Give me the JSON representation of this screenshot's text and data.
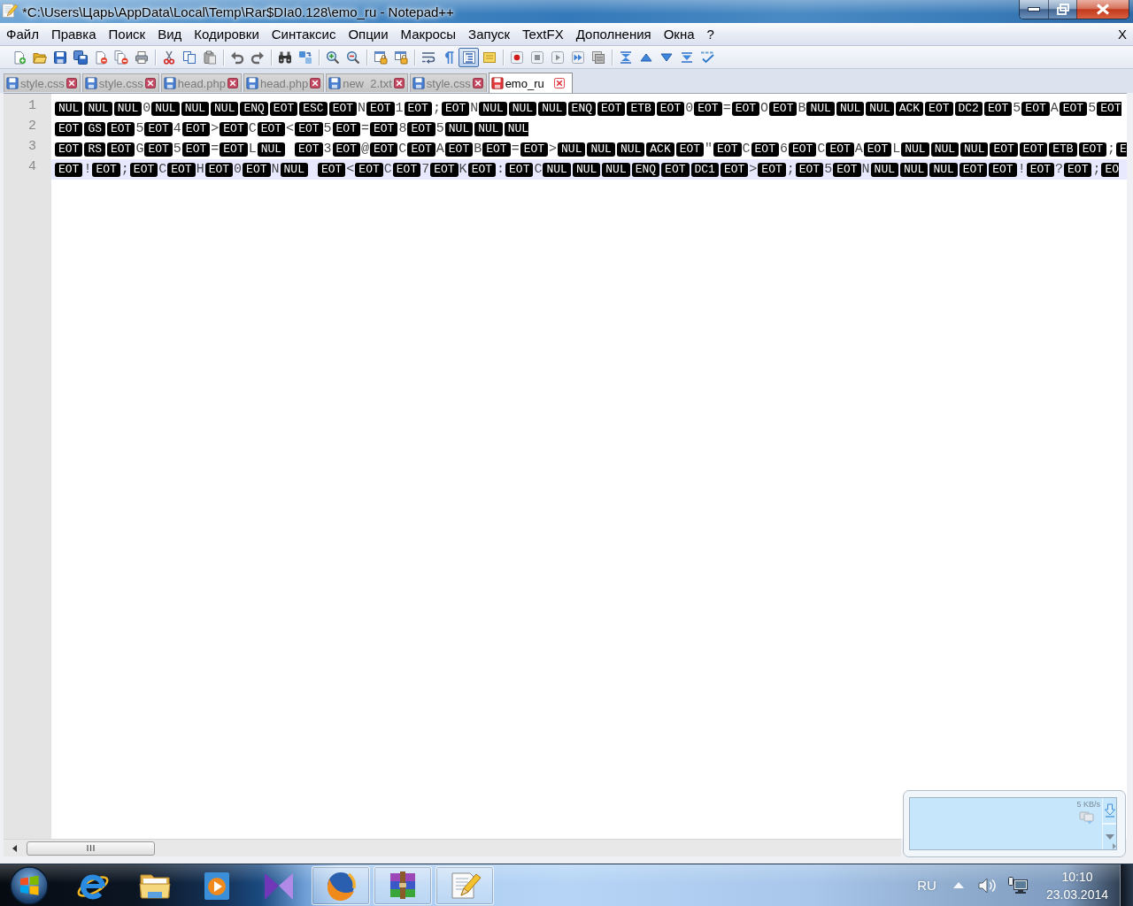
{
  "window": {
    "title": "*C:\\Users\\Царь\\AppData\\Local\\Temp\\Rar$DIa0.128\\emo_ru - Notepad++"
  },
  "menu": {
    "items": [
      "Файл",
      "Правка",
      "Поиск",
      "Вид",
      "Кодировки",
      "Синтаксис",
      "Опции",
      "Макросы",
      "Запуск",
      "TextFX",
      "Дополнения",
      "Окна",
      "?"
    ],
    "close": "X"
  },
  "toolbar": {
    "groups": [
      [
        {
          "kind": "new",
          "pressed": false
        },
        {
          "kind": "open",
          "pressed": false
        },
        {
          "kind": "save",
          "pressed": false
        },
        {
          "kind": "saveall",
          "pressed": false
        },
        {
          "kind": "close",
          "pressed": false
        },
        {
          "kind": "closeall",
          "pressed": false
        },
        {
          "kind": "print",
          "pressed": false
        }
      ],
      [
        {
          "kind": "cut",
          "pressed": false
        },
        {
          "kind": "copy",
          "pressed": false
        },
        {
          "kind": "paste",
          "pressed": false
        }
      ],
      [
        {
          "kind": "undo",
          "pressed": false
        },
        {
          "kind": "redo",
          "pressed": false
        }
      ],
      [
        {
          "kind": "find",
          "pressed": false
        },
        {
          "kind": "replace",
          "pressed": false
        }
      ],
      [
        {
          "kind": "zoomin",
          "pressed": false
        },
        {
          "kind": "zoomout",
          "pressed": false
        }
      ],
      [
        {
          "kind": "syncv",
          "pressed": false
        },
        {
          "kind": "synch",
          "pressed": false
        }
      ],
      [
        {
          "kind": "wrap",
          "pressed": false
        },
        {
          "kind": "allchars",
          "pressed": false
        },
        {
          "kind": "indent",
          "pressed": true
        },
        {
          "kind": "userlang",
          "pressed": false
        }
      ],
      [
        {
          "kind": "record",
          "pressed": false
        },
        {
          "kind": "stop",
          "pressed": false
        },
        {
          "kind": "play",
          "pressed": false
        },
        {
          "kind": "playmulti",
          "pressed": false
        },
        {
          "kind": "savemacro",
          "pressed": false
        }
      ],
      [
        {
          "kind": "collapse",
          "pressed": false
        },
        {
          "kind": "up",
          "pressed": false
        },
        {
          "kind": "down",
          "pressed": false
        },
        {
          "kind": "expand",
          "pressed": false
        },
        {
          "kind": "spell",
          "pressed": false
        }
      ]
    ]
  },
  "tabs": [
    {
      "label": "style.css",
      "selected": false,
      "modified": false
    },
    {
      "label": "style.css",
      "selected": false,
      "modified": false
    },
    {
      "label": "head.php",
      "selected": false,
      "modified": false
    },
    {
      "label": "head.php",
      "selected": false,
      "modified": false
    },
    {
      "label": "new  2.txt",
      "selected": false,
      "modified": false
    },
    {
      "label": "style.css",
      "selected": false,
      "modified": false
    },
    {
      "label": "emo_ru",
      "selected": true,
      "modified": true
    }
  ],
  "editor": {
    "lines": [
      {
        "number": "1",
        "current": false,
        "tokens": [
          {
            "kind": "control",
            "text": "NUL"
          },
          {
            "kind": "control",
            "text": "NUL"
          },
          {
            "kind": "control",
            "text": "NUL"
          },
          {
            "kind": "char",
            "text": "0"
          },
          {
            "kind": "control",
            "text": "NUL"
          },
          {
            "kind": "control",
            "text": "NUL"
          },
          {
            "kind": "control",
            "text": "NUL"
          },
          {
            "kind": "control",
            "text": "ENQ"
          },
          {
            "kind": "control",
            "text": "EOT"
          },
          {
            "kind": "control",
            "text": "ESC"
          },
          {
            "kind": "control",
            "text": "EOT"
          },
          {
            "kind": "char",
            "text": "N"
          },
          {
            "kind": "control",
            "text": "EOT"
          },
          {
            "kind": "char",
            "text": "1"
          },
          {
            "kind": "control",
            "text": "EOT"
          },
          {
            "kind": "char",
            "text": ";"
          },
          {
            "kind": "control",
            "text": "EOT"
          },
          {
            "kind": "char",
            "text": "N"
          },
          {
            "kind": "control",
            "text": "NUL"
          },
          {
            "kind": "control",
            "text": "NUL"
          },
          {
            "kind": "control",
            "text": "NUL"
          },
          {
            "kind": "control",
            "text": "ENQ"
          },
          {
            "kind": "control",
            "text": "EOT"
          },
          {
            "kind": "control",
            "text": "ETB"
          },
          {
            "kind": "control",
            "text": "EOT"
          },
          {
            "kind": "char",
            "text": "0"
          },
          {
            "kind": "control",
            "text": "EOT"
          },
          {
            "kind": "char",
            "text": "="
          },
          {
            "kind": "control",
            "text": "EOT"
          },
          {
            "kind": "char",
            "text": "O"
          },
          {
            "kind": "control",
            "text": "EOT"
          },
          {
            "kind": "char",
            "text": "B"
          },
          {
            "kind": "control",
            "text": "NUL"
          },
          {
            "kind": "control",
            "text": "NUL"
          },
          {
            "kind": "control",
            "text": "NUL"
          },
          {
            "kind": "control",
            "text": "ACK"
          },
          {
            "kind": "control",
            "text": "EOT"
          },
          {
            "kind": "control",
            "text": "DC2"
          },
          {
            "kind": "control",
            "text": "EOT"
          },
          {
            "kind": "char",
            "text": "5"
          },
          {
            "kind": "control",
            "text": "EOT"
          },
          {
            "kind": "char",
            "text": "A"
          },
          {
            "kind": "control",
            "text": "EOT"
          },
          {
            "kind": "char",
            "text": "5"
          },
          {
            "kind": "control",
            "text": "EOT"
          }
        ]
      },
      {
        "number": "2",
        "current": false,
        "tokens": [
          {
            "kind": "control",
            "text": "EOT"
          },
          {
            "kind": "control",
            "text": "GS"
          },
          {
            "kind": "control",
            "text": "EOT"
          },
          {
            "kind": "char",
            "text": "5"
          },
          {
            "kind": "control",
            "text": "EOT"
          },
          {
            "kind": "char",
            "text": "4"
          },
          {
            "kind": "control",
            "text": "EOT"
          },
          {
            "kind": "char",
            "text": ">"
          },
          {
            "kind": "control",
            "text": "EOT"
          },
          {
            "kind": "char",
            "text": "C"
          },
          {
            "kind": "control",
            "text": "EOT"
          },
          {
            "kind": "char",
            "text": "<"
          },
          {
            "kind": "control",
            "text": "EOT"
          },
          {
            "kind": "char",
            "text": "5"
          },
          {
            "kind": "control",
            "text": "EOT"
          },
          {
            "kind": "char",
            "text": "="
          },
          {
            "kind": "control",
            "text": "EOT"
          },
          {
            "kind": "char",
            "text": "8"
          },
          {
            "kind": "control",
            "text": "EOT"
          },
          {
            "kind": "char",
            "text": "5"
          },
          {
            "kind": "control",
            "text": "NUL"
          },
          {
            "kind": "control",
            "text": "NUL"
          },
          {
            "kind": "control",
            "text": "NUL"
          }
        ]
      },
      {
        "number": "3",
        "current": false,
        "tokens": [
          {
            "kind": "control",
            "text": "EOT"
          },
          {
            "kind": "control",
            "text": "RS"
          },
          {
            "kind": "control",
            "text": "EOT"
          },
          {
            "kind": "char",
            "text": "G"
          },
          {
            "kind": "control",
            "text": "EOT"
          },
          {
            "kind": "char",
            "text": "5"
          },
          {
            "kind": "control",
            "text": "EOT"
          },
          {
            "kind": "char",
            "text": "="
          },
          {
            "kind": "control",
            "text": "EOT"
          },
          {
            "kind": "char",
            "text": "L"
          },
          {
            "kind": "control",
            "text": "NUL"
          },
          {
            "kind": "space"
          },
          {
            "kind": "control",
            "text": "EOT"
          },
          {
            "kind": "char",
            "text": "3"
          },
          {
            "kind": "control",
            "text": "EOT"
          },
          {
            "kind": "char",
            "text": "@"
          },
          {
            "kind": "control",
            "text": "EOT"
          },
          {
            "kind": "char",
            "text": "C"
          },
          {
            "kind": "control",
            "text": "EOT"
          },
          {
            "kind": "char",
            "text": "A"
          },
          {
            "kind": "control",
            "text": "EOT"
          },
          {
            "kind": "char",
            "text": "B"
          },
          {
            "kind": "control",
            "text": "EOT"
          },
          {
            "kind": "char",
            "text": "="
          },
          {
            "kind": "control",
            "text": "EOT"
          },
          {
            "kind": "char",
            "text": ">"
          },
          {
            "kind": "control",
            "text": "NUL"
          },
          {
            "kind": "control",
            "text": "NUL"
          },
          {
            "kind": "control",
            "text": "NUL"
          },
          {
            "kind": "control",
            "text": "ACK"
          },
          {
            "kind": "control",
            "text": "EOT"
          },
          {
            "kind": "char",
            "text": "\""
          },
          {
            "kind": "control",
            "text": "EOT"
          },
          {
            "kind": "char",
            "text": "C"
          },
          {
            "kind": "control",
            "text": "EOT"
          },
          {
            "kind": "char",
            "text": "6"
          },
          {
            "kind": "control",
            "text": "EOT"
          },
          {
            "kind": "char",
            "text": "C"
          },
          {
            "kind": "control",
            "text": "EOT"
          },
          {
            "kind": "char",
            "text": "A"
          },
          {
            "kind": "control",
            "text": "EOT"
          },
          {
            "kind": "char",
            "text": "L"
          },
          {
            "kind": "control",
            "text": "NUL"
          },
          {
            "kind": "control",
            "text": "NUL"
          },
          {
            "kind": "control",
            "text": "NUL"
          },
          {
            "kind": "control",
            "text": "EOT"
          },
          {
            "kind": "control",
            "text": "EOT"
          },
          {
            "kind": "control",
            "text": "ETB"
          },
          {
            "kind": "control",
            "text": "EOT"
          },
          {
            "kind": "char",
            "text": ";"
          },
          {
            "kind": "control",
            "text": "E"
          }
        ]
      },
      {
        "number": "4",
        "current": true,
        "tokens": [
          {
            "kind": "control",
            "text": "EOT"
          },
          {
            "kind": "char",
            "text": "!"
          },
          {
            "kind": "control",
            "text": "EOT"
          },
          {
            "kind": "char",
            "text": ";"
          },
          {
            "kind": "control",
            "text": "EOT"
          },
          {
            "kind": "char",
            "text": "C"
          },
          {
            "kind": "control",
            "text": "EOT"
          },
          {
            "kind": "char",
            "text": "H"
          },
          {
            "kind": "control",
            "text": "EOT"
          },
          {
            "kind": "char",
            "text": "0"
          },
          {
            "kind": "control",
            "text": "EOT"
          },
          {
            "kind": "char",
            "text": "N"
          },
          {
            "kind": "control",
            "text": "NUL"
          },
          {
            "kind": "space"
          },
          {
            "kind": "control",
            "text": "EOT"
          },
          {
            "kind": "char",
            "text": "<"
          },
          {
            "kind": "control",
            "text": "EOT"
          },
          {
            "kind": "char",
            "text": "C"
          },
          {
            "kind": "control",
            "text": "EOT"
          },
          {
            "kind": "char",
            "text": "7"
          },
          {
            "kind": "control",
            "text": "EOT"
          },
          {
            "kind": "char",
            "text": "K"
          },
          {
            "kind": "control",
            "text": "EOT"
          },
          {
            "kind": "char",
            "text": ":"
          },
          {
            "kind": "control",
            "text": "EOT"
          },
          {
            "kind": "char",
            "text": "C"
          },
          {
            "kind": "control",
            "text": "NUL"
          },
          {
            "kind": "control",
            "text": "NUL"
          },
          {
            "kind": "control",
            "text": "NUL"
          },
          {
            "kind": "control",
            "text": "ENQ"
          },
          {
            "kind": "control",
            "text": "EOT"
          },
          {
            "kind": "control",
            "text": "DC1"
          },
          {
            "kind": "control",
            "text": "EOT"
          },
          {
            "kind": "char",
            "text": ">"
          },
          {
            "kind": "control",
            "text": "EOT"
          },
          {
            "kind": "char",
            "text": ";"
          },
          {
            "kind": "control",
            "text": "EOT"
          },
          {
            "kind": "char",
            "text": "5"
          },
          {
            "kind": "control",
            "text": "EOT"
          },
          {
            "kind": "char",
            "text": "N"
          },
          {
            "kind": "control",
            "text": "NUL"
          },
          {
            "kind": "control",
            "text": "NUL"
          },
          {
            "kind": "control",
            "text": "NUL"
          },
          {
            "kind": "control",
            "text": "EOT"
          },
          {
            "kind": "control",
            "text": "EOT"
          },
          {
            "kind": "char",
            "text": "!"
          },
          {
            "kind": "control",
            "text": "EOT"
          },
          {
            "kind": "char",
            "text": "?"
          },
          {
            "kind": "control",
            "text": "EOT"
          },
          {
            "kind": "char",
            "text": ";"
          },
          {
            "kind": "control",
            "text": "EO"
          }
        ]
      }
    ]
  },
  "meter": {
    "rate": "5 KB/s"
  },
  "taskbar": {
    "apps": [
      {
        "kind": "eweb",
        "running": false
      },
      {
        "kind": "folder",
        "running": false
      },
      {
        "kind": "media",
        "running": false
      },
      {
        "kind": "bowtie",
        "running": false
      },
      {
        "kind": "foxweb",
        "running": true
      },
      {
        "kind": "archive",
        "running": true
      },
      {
        "kind": "notepad",
        "running": true
      }
    ],
    "tray": {
      "language": "RU",
      "time": "10:10",
      "date": "23.03.2014"
    }
  }
}
